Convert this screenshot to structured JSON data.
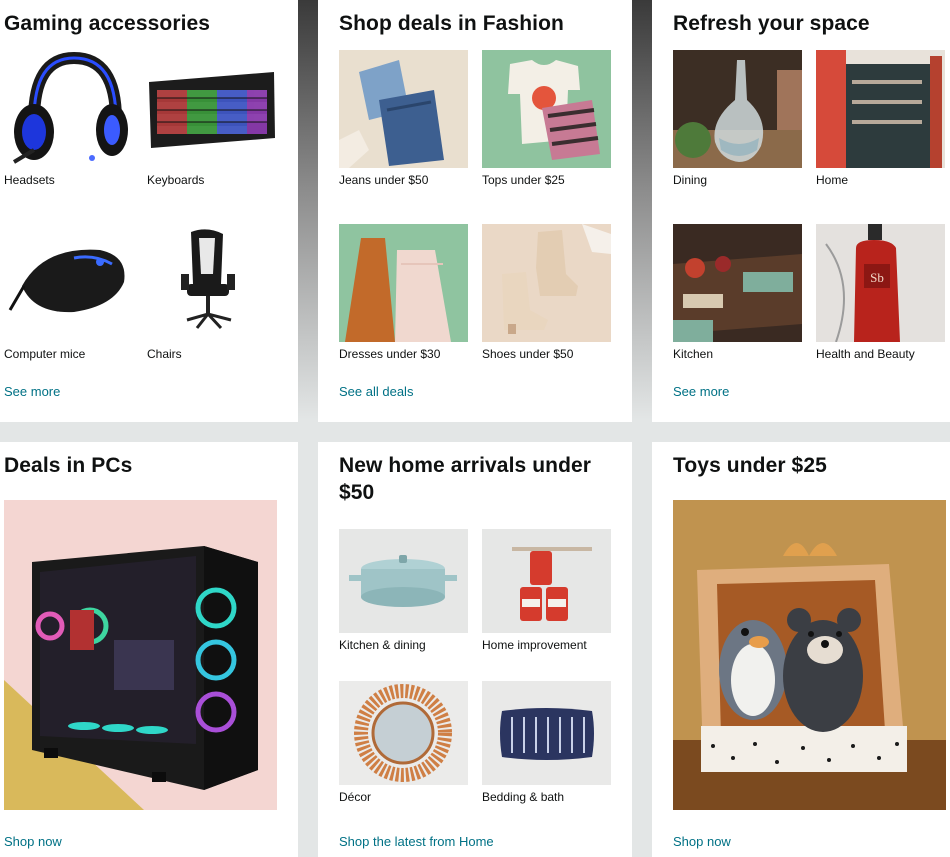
{
  "cards": {
    "gaming": {
      "title": "Gaming accessories",
      "items": [
        "Headsets",
        "Keyboards",
        "Computer mice",
        "Chairs"
      ],
      "link": "See more"
    },
    "fashion": {
      "title": "Shop deals in Fashion",
      "items": [
        "Jeans under $50",
        "Tops under $25",
        "Dresses under $30",
        "Shoes under $50"
      ],
      "link": "See all deals"
    },
    "refresh": {
      "title": "Refresh your space",
      "items": [
        "Dining",
        "Home",
        "Kitchen",
        "Health and Beauty"
      ],
      "link": "See more"
    },
    "pcs": {
      "title": "Deals in PCs",
      "link": "Shop now"
    },
    "home": {
      "title": "New home arrivals under $50",
      "items": [
        "Kitchen & dining",
        "Home improvement",
        "Décor",
        "Bedding & bath"
      ],
      "link": "Shop the latest from Home"
    },
    "toys": {
      "title": "Toys under $25",
      "link": "Shop now"
    }
  },
  "colors": {
    "page_bg": "#e3e6e6",
    "card_bg": "#ffffff",
    "link": "#007185",
    "title": "#0f1111"
  },
  "icons": [
    "headset-image",
    "keyboard-image",
    "mouse-image",
    "chair-image",
    "pc-image",
    "toys-image"
  ]
}
